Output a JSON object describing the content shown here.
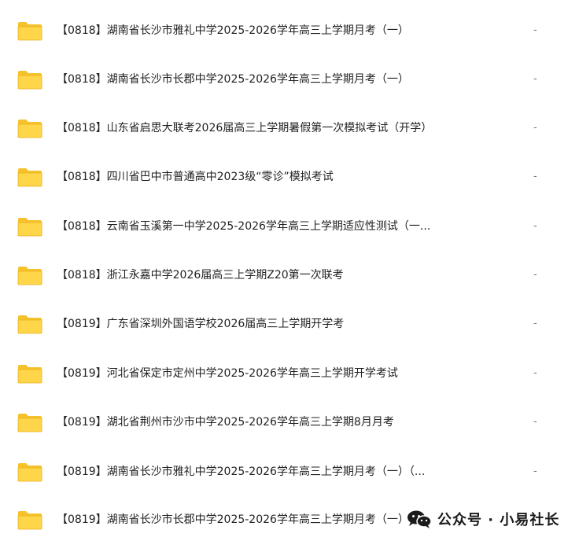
{
  "colors": {
    "folder_body": "#FFD54A",
    "folder_tab": "#F6C22B",
    "folder_edge": "#E8B21E",
    "text": "#222222",
    "muted": "#777777"
  },
  "files": [
    {
      "icon": "folder-icon",
      "name": "【0818】湖南省长沙市雅礼中学2025-2026学年高三上学期月考（一）",
      "size": "-"
    },
    {
      "icon": "folder-icon",
      "name": "【0818】湖南省长沙市长郡中学2025-2026学年高三上学期月考（一）",
      "size": "-"
    },
    {
      "icon": "folder-icon",
      "name": "【0818】山东省启思大联考2026届高三上学期暑假第一次模拟考试（开学）",
      "size": "-"
    },
    {
      "icon": "folder-icon",
      "name": "【0818】四川省巴中市普通高中2023级“零诊”模拟考试",
      "size": "-"
    },
    {
      "icon": "folder-icon",
      "name": "【0818】云南省玉溪第一中学2025-2026学年高三上学期适应性测试（一...",
      "size": "-"
    },
    {
      "icon": "folder-icon",
      "name": "【0818】浙江永嘉中学2026届高三上学期Z20第一次联考",
      "size": "-"
    },
    {
      "icon": "folder-icon",
      "name": "【0819】广东省深圳外国语学校2026届高三上学期开学考",
      "size": "-"
    },
    {
      "icon": "folder-icon",
      "name": "【0819】河北省保定市定州中学2025-2026学年高三上学期开学考试",
      "size": "-"
    },
    {
      "icon": "folder-icon",
      "name": "【0819】湖北省荆州市沙市中学2025-2026学年高三上学期8月月考",
      "size": "-"
    },
    {
      "icon": "folder-icon",
      "name": "【0819】湖南省长沙市雅礼中学2025-2026学年高三上学期月考（一）（...",
      "size": "-"
    },
    {
      "icon": "folder-icon",
      "name": "【0819】湖南省长沙市长郡中学2025-2026学年高三上学期月考（一）",
      "size": "-"
    }
  ],
  "watermark": {
    "icon": "wechat-icon",
    "text": "公众号 · 小易社长"
  }
}
